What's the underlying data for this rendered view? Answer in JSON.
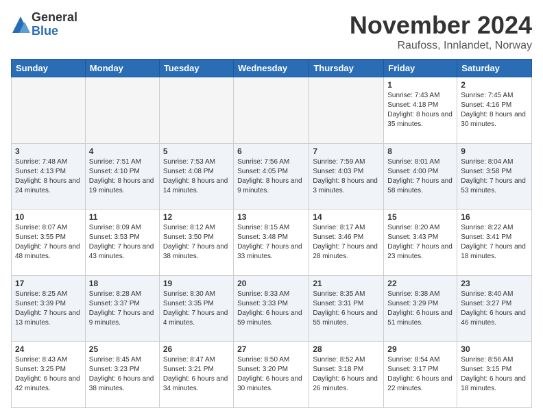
{
  "logo": {
    "general": "General",
    "blue": "Blue"
  },
  "title": "November 2024",
  "location": "Raufoss, Innlandet, Norway",
  "weekdays": [
    "Sunday",
    "Monday",
    "Tuesday",
    "Wednesday",
    "Thursday",
    "Friday",
    "Saturday"
  ],
  "weeks": [
    [
      {
        "day": "",
        "info": ""
      },
      {
        "day": "",
        "info": ""
      },
      {
        "day": "",
        "info": ""
      },
      {
        "day": "",
        "info": ""
      },
      {
        "day": "",
        "info": ""
      },
      {
        "day": "1",
        "info": "Sunrise: 7:43 AM\nSunset: 4:18 PM\nDaylight: 8 hours\nand 35 minutes."
      },
      {
        "day": "2",
        "info": "Sunrise: 7:45 AM\nSunset: 4:16 PM\nDaylight: 8 hours\nand 30 minutes."
      }
    ],
    [
      {
        "day": "3",
        "info": "Sunrise: 7:48 AM\nSunset: 4:13 PM\nDaylight: 8 hours\nand 24 minutes."
      },
      {
        "day": "4",
        "info": "Sunrise: 7:51 AM\nSunset: 4:10 PM\nDaylight: 8 hours\nand 19 minutes."
      },
      {
        "day": "5",
        "info": "Sunrise: 7:53 AM\nSunset: 4:08 PM\nDaylight: 8 hours\nand 14 minutes."
      },
      {
        "day": "6",
        "info": "Sunrise: 7:56 AM\nSunset: 4:05 PM\nDaylight: 8 hours\nand 9 minutes."
      },
      {
        "day": "7",
        "info": "Sunrise: 7:59 AM\nSunset: 4:03 PM\nDaylight: 8 hours\nand 3 minutes."
      },
      {
        "day": "8",
        "info": "Sunrise: 8:01 AM\nSunset: 4:00 PM\nDaylight: 7 hours\nand 58 minutes."
      },
      {
        "day": "9",
        "info": "Sunrise: 8:04 AM\nSunset: 3:58 PM\nDaylight: 7 hours\nand 53 minutes."
      }
    ],
    [
      {
        "day": "10",
        "info": "Sunrise: 8:07 AM\nSunset: 3:55 PM\nDaylight: 7 hours\nand 48 minutes."
      },
      {
        "day": "11",
        "info": "Sunrise: 8:09 AM\nSunset: 3:53 PM\nDaylight: 7 hours\nand 43 minutes."
      },
      {
        "day": "12",
        "info": "Sunrise: 8:12 AM\nSunset: 3:50 PM\nDaylight: 7 hours\nand 38 minutes."
      },
      {
        "day": "13",
        "info": "Sunrise: 8:15 AM\nSunset: 3:48 PM\nDaylight: 7 hours\nand 33 minutes."
      },
      {
        "day": "14",
        "info": "Sunrise: 8:17 AM\nSunset: 3:46 PM\nDaylight: 7 hours\nand 28 minutes."
      },
      {
        "day": "15",
        "info": "Sunrise: 8:20 AM\nSunset: 3:43 PM\nDaylight: 7 hours\nand 23 minutes."
      },
      {
        "day": "16",
        "info": "Sunrise: 8:22 AM\nSunset: 3:41 PM\nDaylight: 7 hours\nand 18 minutes."
      }
    ],
    [
      {
        "day": "17",
        "info": "Sunrise: 8:25 AM\nSunset: 3:39 PM\nDaylight: 7 hours\nand 13 minutes."
      },
      {
        "day": "18",
        "info": "Sunrise: 8:28 AM\nSunset: 3:37 PM\nDaylight: 7 hours\nand 9 minutes."
      },
      {
        "day": "19",
        "info": "Sunrise: 8:30 AM\nSunset: 3:35 PM\nDaylight: 7 hours\nand 4 minutes."
      },
      {
        "day": "20",
        "info": "Sunrise: 8:33 AM\nSunset: 3:33 PM\nDaylight: 6 hours\nand 59 minutes."
      },
      {
        "day": "21",
        "info": "Sunrise: 8:35 AM\nSunset: 3:31 PM\nDaylight: 6 hours\nand 55 minutes."
      },
      {
        "day": "22",
        "info": "Sunrise: 8:38 AM\nSunset: 3:29 PM\nDaylight: 6 hours\nand 51 minutes."
      },
      {
        "day": "23",
        "info": "Sunrise: 8:40 AM\nSunset: 3:27 PM\nDaylight: 6 hours\nand 46 minutes."
      }
    ],
    [
      {
        "day": "24",
        "info": "Sunrise: 8:43 AM\nSunset: 3:25 PM\nDaylight: 6 hours\nand 42 minutes."
      },
      {
        "day": "25",
        "info": "Sunrise: 8:45 AM\nSunset: 3:23 PM\nDaylight: 6 hours\nand 38 minutes."
      },
      {
        "day": "26",
        "info": "Sunrise: 8:47 AM\nSunset: 3:21 PM\nDaylight: 6 hours\nand 34 minutes."
      },
      {
        "day": "27",
        "info": "Sunrise: 8:50 AM\nSunset: 3:20 PM\nDaylight: 6 hours\nand 30 minutes."
      },
      {
        "day": "28",
        "info": "Sunrise: 8:52 AM\nSunset: 3:18 PM\nDaylight: 6 hours\nand 26 minutes."
      },
      {
        "day": "29",
        "info": "Sunrise: 8:54 AM\nSunset: 3:17 PM\nDaylight: 6 hours\nand 22 minutes."
      },
      {
        "day": "30",
        "info": "Sunrise: 8:56 AM\nSunset: 3:15 PM\nDaylight: 6 hours\nand 18 minutes."
      }
    ]
  ]
}
